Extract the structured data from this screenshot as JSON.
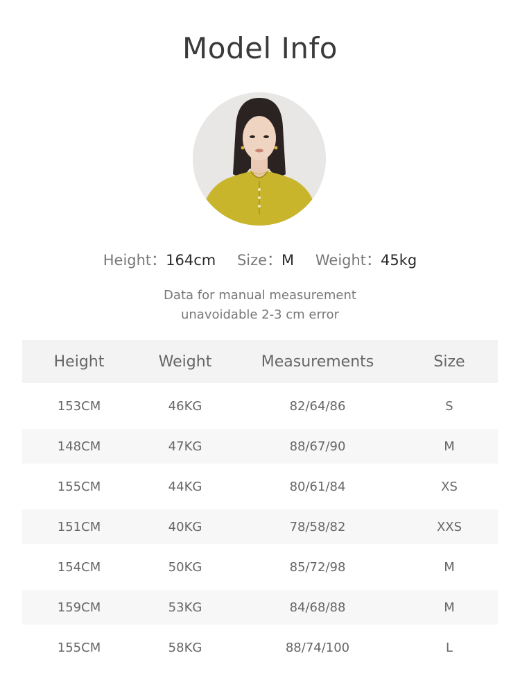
{
  "header": {
    "title": "Model Info"
  },
  "model": {
    "height_label": "Height：",
    "height_value": "164cm",
    "size_label": "Size：",
    "size_value": "M",
    "weight_label": "Weight：",
    "weight_value": "45kg"
  },
  "note": {
    "line1": "Data for manual measurement",
    "line2": "unavoidable 2-3 cm error"
  },
  "table": {
    "columns": [
      "Height",
      "Weight",
      "Measurements",
      "Size"
    ],
    "rows": [
      [
        "153CM",
        "46KG",
        "82/64/86",
        "S"
      ],
      [
        "148CM",
        "47KG",
        "88/67/90",
        "M"
      ],
      [
        "155CM",
        "44KG",
        "80/61/84",
        "XS"
      ],
      [
        "151CM",
        "40KG",
        "78/58/82",
        "XXS"
      ],
      [
        "154CM",
        "50KG",
        "85/72/98",
        "M"
      ],
      [
        "159CM",
        "53KG",
        "84/68/88",
        "M"
      ],
      [
        "155CM",
        "58KG",
        "88/74/100",
        "L"
      ]
    ]
  },
  "colors": {
    "header_bg": "#f3f3f3",
    "alt_row_bg": "#f7f7f7",
    "blouse": "#c9b52c"
  }
}
